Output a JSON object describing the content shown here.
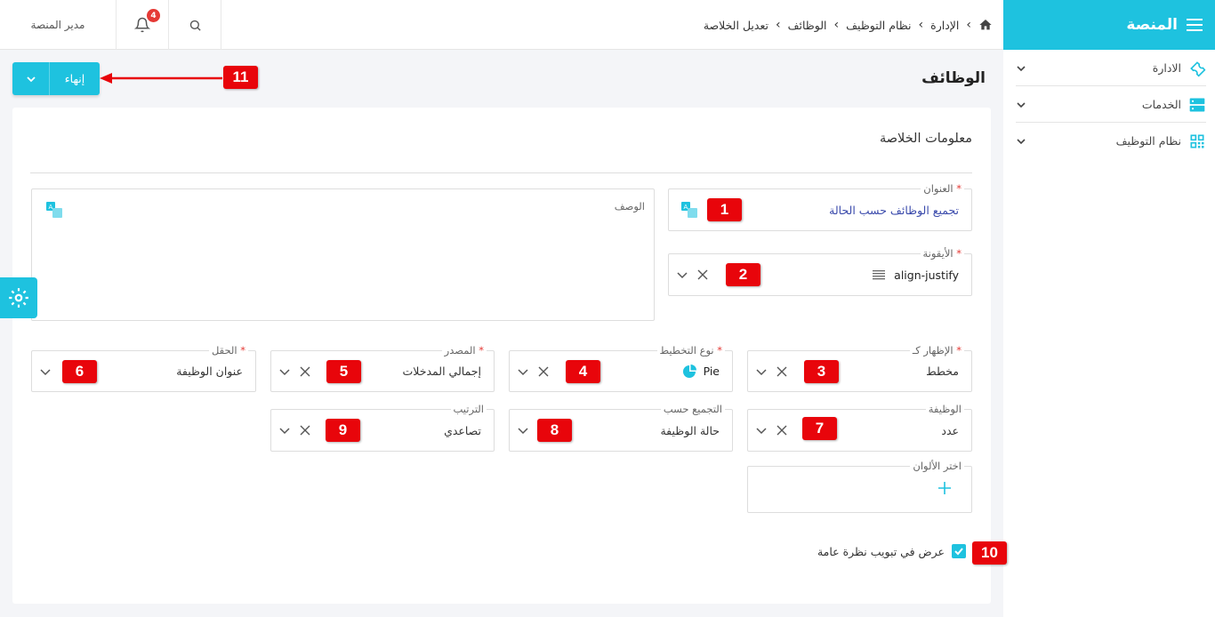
{
  "app": {
    "brand": "المنصة",
    "user": "مدير المنصة",
    "notifications": "4"
  },
  "breadcrumb": [
    "الإدارة",
    "نظام التوظيف",
    "الوظائف",
    "تعديل الخلاصة"
  ],
  "sidebar": {
    "items": [
      {
        "label": "الادارة",
        "icon": "wrench-icon"
      },
      {
        "label": "الخدمات",
        "icon": "server-icon"
      },
      {
        "label": "نظام التوظيف",
        "icon": "qr-icon"
      }
    ]
  },
  "page": {
    "title": "الوظائف",
    "finish_label": "إنهاء",
    "section_title": "معلومات الخلاصة"
  },
  "form": {
    "title_label": "العنوان",
    "title_value": "تجميع الوظائف حسب الحالة",
    "desc_label": "الوصف",
    "icon_label": "الأيقونة",
    "icon_value": "align-justify",
    "display_label": "الإظهار كـ",
    "display_value": "مخطط",
    "chart_type_label": "نوع التخطيط",
    "chart_type_value": "Pie",
    "source_label": "المصدر",
    "source_value": "إجمالي المدخلات",
    "field_label": "الحقل",
    "field_value": "عنوان الوظيفة",
    "function_label": "الوظيفة",
    "function_value": "عدد",
    "group_label": "التجميع حسب",
    "group_value": "حالة الوظيفة",
    "order_label": "الترتيب",
    "order_value": "تصاعدي",
    "colors_label": "اختر الألوان",
    "overview_label": "عرض في تبويب نظرة عامة"
  },
  "annotations": [
    "1",
    "2",
    "3",
    "4",
    "5",
    "6",
    "7",
    "8",
    "9",
    "10",
    "11"
  ],
  "colors": {
    "accent": "#1ec2df",
    "marker": "#e8050b"
  }
}
